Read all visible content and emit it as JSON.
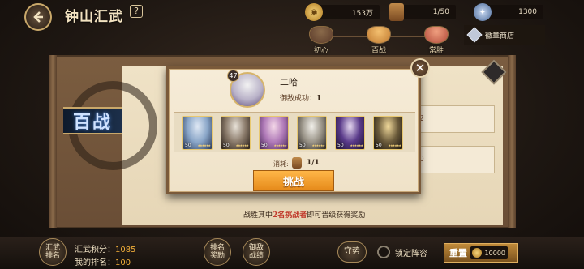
{
  "header": {
    "title": "钟山汇武",
    "help_symbol": "?",
    "resources": [
      {
        "icon": "coin-icon",
        "value": "153万"
      },
      {
        "icon": "scroll-ticket-icon",
        "value": "1/50"
      },
      {
        "icon": "badge-medal-icon",
        "value": "1300"
      }
    ]
  },
  "difficulty_tabs": [
    {
      "label": "初心",
      "color": "#5a3a2a"
    },
    {
      "label": "百战",
      "color": "#c07a30"
    },
    {
      "label": "常胜",
      "color": "#b24a3a"
    }
  ],
  "badge_shop": {
    "label": "徽章商店"
  },
  "mode_banner": {
    "label": "百战"
  },
  "background_rows": [
    {
      "value": "2"
    },
    {
      "value": "0"
    }
  ],
  "victory_hint": {
    "prefix": "战胜其中",
    "highlight": "2名挑战者",
    "suffix": "即可晋级获得奖励"
  },
  "popup": {
    "opponent": {
      "level": "47",
      "name": "二哈",
      "defend_label": "御敌成功：",
      "defend_count": "1"
    },
    "team": [
      {
        "level": "50",
        "stars": "★★★★★★",
        "palette": [
          "#dfe8f4",
          "#8aa6c8",
          "#2a3a5a"
        ]
      },
      {
        "level": "50",
        "stars": "★★★★★★",
        "palette": [
          "#e8e2d8",
          "#8a7a6a",
          "#2a2018"
        ]
      },
      {
        "level": "50",
        "stars": "★★★★★★",
        "palette": [
          "#f4d8e8",
          "#b07ab8",
          "#4a2a5a"
        ]
      },
      {
        "level": "50",
        "stars": "★★★★★★",
        "palette": [
          "#f2f0ea",
          "#9a9488",
          "#2a2624"
        ]
      },
      {
        "level": "50",
        "stars": "★★★★★★",
        "palette": [
          "#e6d8f0",
          "#5a3a8a",
          "#1a1230"
        ]
      },
      {
        "level": "50",
        "stars": "★★★★★★",
        "palette": [
          "#f0d89a",
          "#6a5a3a",
          "#1a1410"
        ]
      }
    ],
    "cost_label": "消耗:",
    "cost_value": "1/1",
    "challenge_label": "挑战",
    "close_symbol": "✕"
  },
  "bottom_bar": {
    "rank_button": "汇武排名",
    "score_label": "汇武积分：",
    "score_value": "1085",
    "my_rank_label": "我的排名：",
    "my_rank_value": "100",
    "rank_reward_button": "排名奖励",
    "defense_record_button": "御敌战绩",
    "guard_button": "守势",
    "lock_lineup_label": "锁定阵容",
    "reset_label": "重置",
    "reset_cost": "10000"
  }
}
